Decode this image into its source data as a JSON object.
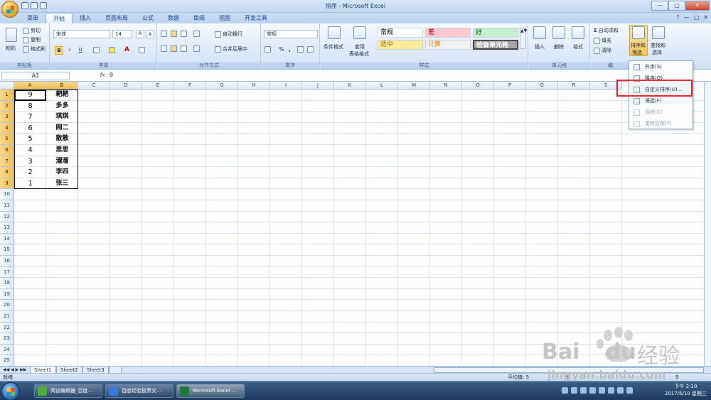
{
  "window": {
    "title": "排序 - Microsoft Excel",
    "controls": [
      "—",
      "▢",
      "✕"
    ]
  },
  "qat": {
    "items": [
      "save-icon",
      "undo-icon",
      "redo-icon"
    ]
  },
  "tabs": [
    {
      "label": "菜单"
    },
    {
      "label": "开始"
    },
    {
      "label": "插入"
    },
    {
      "label": "页面布局"
    },
    {
      "label": "公式"
    },
    {
      "label": "数据"
    },
    {
      "label": "审阅"
    },
    {
      "label": "视图"
    },
    {
      "label": "开发工具"
    }
  ],
  "ribbon": {
    "clipboard": {
      "label": "剪贴板",
      "paste": "粘贴",
      "cut": "剪切",
      "copy": "复制",
      "format_painter": "格式刷"
    },
    "font": {
      "label": "字体",
      "name": "宋体",
      "size": "14",
      "bold": "B",
      "italic": "I",
      "underline": "U"
    },
    "align": {
      "label": "对齐方式",
      "wrap": "自动换行",
      "merge": "合并后居中"
    },
    "number": {
      "label": "数字",
      "format": "常规",
      "percent": "%",
      "comma": ","
    },
    "styles": {
      "label": "样式",
      "conditional": "条件格式",
      "table_format_1": "套用",
      "table_format_2": "表格格式",
      "cells": [
        {
          "text": "常规",
          "bg": "#ffffff",
          "color": "#000000"
        },
        {
          "text": "差",
          "bg": "#ffc7ce",
          "color": "#9c0006"
        },
        {
          "text": "好",
          "bg": "#c6efce",
          "color": "#006100"
        },
        {
          "text": "适中",
          "bg": "#ffeb9c",
          "color": "#9c6500"
        },
        {
          "text": "计算",
          "bg": "#f2f2f2",
          "color": "#fa7d00"
        },
        {
          "text": "检查单元格",
          "bg": "#a5a5a5",
          "color": "#ffffff"
        }
      ]
    },
    "cells": {
      "label": "单元格",
      "insert": "插入",
      "delete": "删除",
      "format": "格式"
    },
    "editing": {
      "label": "编",
      "autosum": "自动求和",
      "fill": "填充",
      "clear": "清除",
      "sort_1": "排序和",
      "sort_2": "筛选",
      "find_1": "查找和",
      "find_2": "选择"
    }
  },
  "formula": {
    "namebox": "A1",
    "fx": "fx",
    "value": "9"
  },
  "columns": [
    "A",
    "B",
    "C",
    "D",
    "E",
    "F",
    "G",
    "H",
    "I",
    "J",
    "K",
    "L",
    "M",
    "N",
    "O",
    "P",
    "Q",
    "R",
    "S"
  ],
  "rows": [
    "1",
    "2",
    "3",
    "4",
    "5",
    "6",
    "7",
    "8",
    "9",
    "10",
    "11",
    "12",
    "13",
    "14",
    "15",
    "16",
    "17",
    "18",
    "19",
    "20",
    "21",
    "22",
    "23",
    "24",
    "25"
  ],
  "cells": [
    {
      "a": "9",
      "b": "耙耙"
    },
    {
      "a": "8",
      "b": "多多"
    },
    {
      "a": "7",
      "b": "琪琪"
    },
    {
      "a": "6",
      "b": "网二"
    },
    {
      "a": "5",
      "b": "散散"
    },
    {
      "a": "4",
      "b": "思思"
    },
    {
      "a": "3",
      "b": "溜溜"
    },
    {
      "a": "2",
      "b": "李四"
    },
    {
      "a": "1",
      "b": "张三"
    }
  ],
  "sort_menu": [
    {
      "label": "升序(S)",
      "icon": "sort-asc-icon",
      "enabled": true
    },
    {
      "label": "降序(O)",
      "icon": "sort-desc-icon",
      "enabled": true
    },
    {
      "label": "自定义排序(U)...",
      "icon": "custom-sort-icon",
      "enabled": true
    },
    {
      "label": "筛选(F)",
      "icon": "filter-icon",
      "enabled": true
    },
    {
      "label": "清除(C)",
      "icon": "clear-filter-icon",
      "enabled": false
    },
    {
      "label": "重新应用(Y)",
      "icon": "reapply-icon",
      "enabled": false
    }
  ],
  "sheets": [
    "Sheet1",
    "Sheet2",
    "Sheet3"
  ],
  "status": {
    "ready": "就绪",
    "average": "平均值: 5",
    "count": "计",
    "zoom": "9"
  },
  "taskbar": {
    "items": [
      {
        "label": "简设编辑器_百度...",
        "color": "#4fae3a"
      },
      {
        "label": "百度经验投票交...",
        "color": "#3a7bd5"
      },
      {
        "label": "Microsoft Excel ...",
        "color": "#1f7a3a"
      }
    ],
    "time": "下午 2:10",
    "date": "2017/5/10 星期三"
  },
  "watermark": {
    "text1": "Bai",
    "text2": "du",
    "text3": "经验",
    "url": "jingyan.baidu.com"
  }
}
